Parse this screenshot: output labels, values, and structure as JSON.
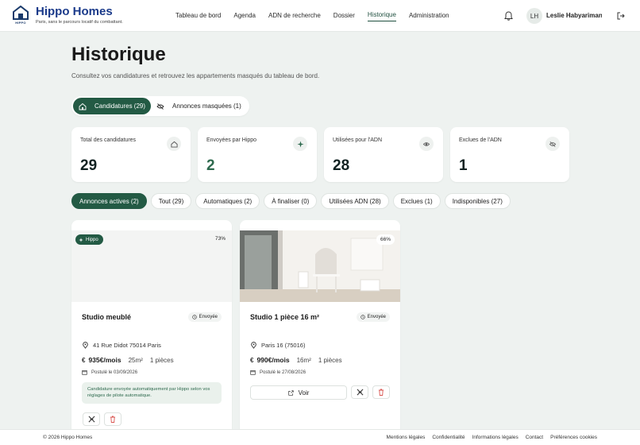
{
  "header": {
    "logo_text": "HIPPO",
    "brand_name": "Hippo Homes",
    "brand_tagline": "Paris, sans le parcours locatif du combattant.",
    "nav": [
      {
        "label": "Tableau de bord"
      },
      {
        "label": "Agenda"
      },
      {
        "label": "ADN de recherche"
      },
      {
        "label": "Dossier"
      },
      {
        "label": "Historique"
      },
      {
        "label": "Administration"
      }
    ],
    "avatar_initials": "LH",
    "user_name": "Leslie Habyarimana",
    "icons": {
      "notifications": "bell-icon",
      "logout": "logout-icon"
    }
  },
  "page": {
    "title": "Historique",
    "subtitle": "Consultez vos candidatures et retrouvez les appartements masqués du tableau de bord."
  },
  "tabs": [
    {
      "label": "Candidatures (29)",
      "icon": "home-icon",
      "active": true
    },
    {
      "label": "Annonces masquées (1)",
      "icon": "eye-off-icon",
      "active": false
    }
  ],
  "stats": [
    {
      "label": "Total des candidatures",
      "value": "29",
      "icon": "home-icon"
    },
    {
      "label": "Envoyées par Hippo",
      "value": "2",
      "icon": "sparkle-icon"
    },
    {
      "label": "Utilisées pour l'ADN",
      "value": "28",
      "icon": "eye-icon"
    },
    {
      "label": "Exclues de l'ADN",
      "value": "1",
      "icon": "eye-off-icon"
    }
  ],
  "filters": [
    {
      "label": "Annonces actives (2)",
      "active": true
    },
    {
      "label": "Tout (29)",
      "active": false
    },
    {
      "label": "Automatiques (2)",
      "active": false
    },
    {
      "label": "À finaliser (0)",
      "active": false
    },
    {
      "label": "Utilisées ADN (28)",
      "active": false
    },
    {
      "label": "Exclues (1)",
      "active": false
    },
    {
      "label": "Indisponibles (27)",
      "active": false
    }
  ],
  "cards": [
    {
      "source_badge": "Hippo",
      "score": "73%",
      "title": "Studio meublé",
      "status": "Envoyée",
      "address": "41 Rue Didot 75014 Paris",
      "price": "935€/mois",
      "surface": "25m²",
      "rooms": "1 pièces",
      "posted": "Postulé le 03/09/2026",
      "note": "Candidature envoyée automatiquement par Hippo selon vos réglages de pilote automatique."
    },
    {
      "score": "66%",
      "title": "Studio 1 pièce 16 m²",
      "status": "Envoyée",
      "address": "Paris 16 (75016)",
      "price": "990€/mois",
      "surface": "16m²",
      "rooms": "1 pièces",
      "posted": "Postulé le 27/08/2026",
      "view_label": "Voir"
    }
  ],
  "footer": {
    "copyright": "© 2026 Hippo Homes",
    "links": [
      "Mentions légales",
      "Confidentialité",
      "Informations légales",
      "Contact",
      "Préférences cookies"
    ]
  },
  "colors": {
    "primary": "#235a44",
    "brand_blue": "#1a3a8a",
    "danger": "#d9534f",
    "background": "#eef2f0"
  }
}
